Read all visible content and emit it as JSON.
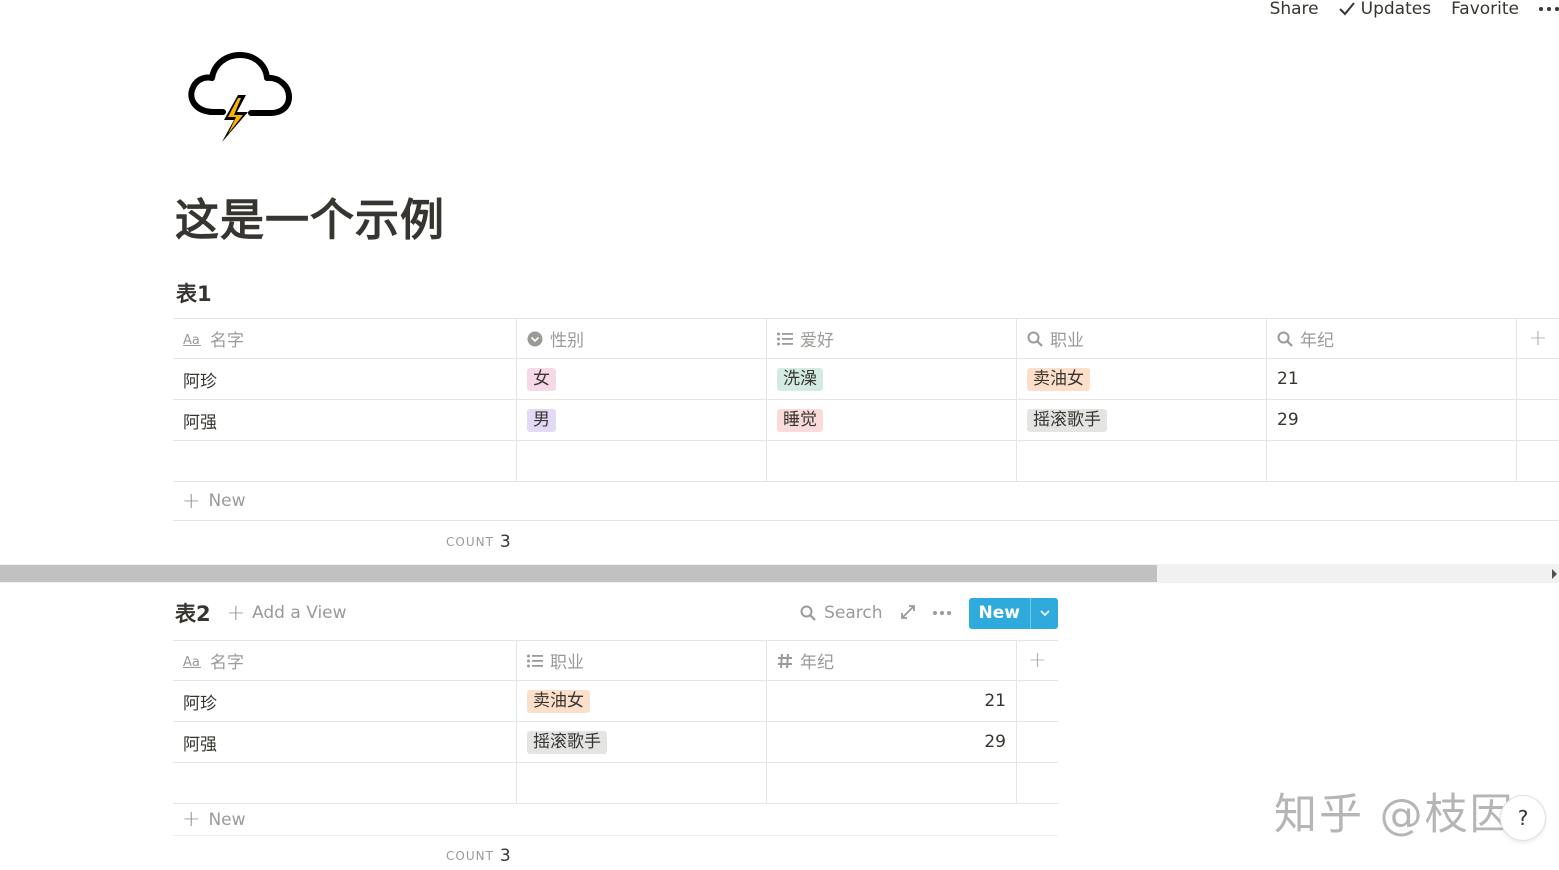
{
  "topbar": {
    "share": "Share",
    "updates": "Updates",
    "favorite": "Favorite"
  },
  "page": {
    "title": "这是一个示例"
  },
  "table1": {
    "title": "表1",
    "columns": [
      "名字",
      "性别",
      "爱好",
      "职业",
      "年纪"
    ],
    "column_icons": [
      "text-aa-icon",
      "select-icon",
      "multi-select-icon",
      "search-icon",
      "search-icon"
    ],
    "rows": [
      {
        "name": "阿珍",
        "gender": "女",
        "hobby": "洗澡",
        "job": "卖油女",
        "age": "21"
      },
      {
        "name": "阿强",
        "gender": "男",
        "hobby": "睡觉",
        "job": "摇滚歌手",
        "age": "29"
      }
    ],
    "new_label": "New",
    "count_label": "COUNT",
    "count_value": "3"
  },
  "table2": {
    "title": "表2",
    "add_view": "Add a View",
    "search": "Search",
    "new_button": "New",
    "columns": [
      "名字",
      "职业",
      "年纪"
    ],
    "column_icons": [
      "text-aa-icon",
      "multi-select-icon",
      "number-hash-icon"
    ],
    "rows": [
      {
        "name": "阿珍",
        "job": "卖油女",
        "age": "21"
      },
      {
        "name": "阿强",
        "job": "摇滚歌手",
        "age": "29"
      }
    ],
    "new_label": "New",
    "count_label": "COUNT",
    "count_value": "3"
  },
  "tag_colors": {
    "女": "#f5d9e7",
    "男": "#e3dbf5",
    "洗澡": "#d3ebe3",
    "睡觉": "#fadada",
    "卖油女": "#fcdfcb",
    "摇滚歌手": "#e4e4e3"
  },
  "accent": "#2eaadc",
  "watermark": "知乎 @枝因",
  "help": "?"
}
